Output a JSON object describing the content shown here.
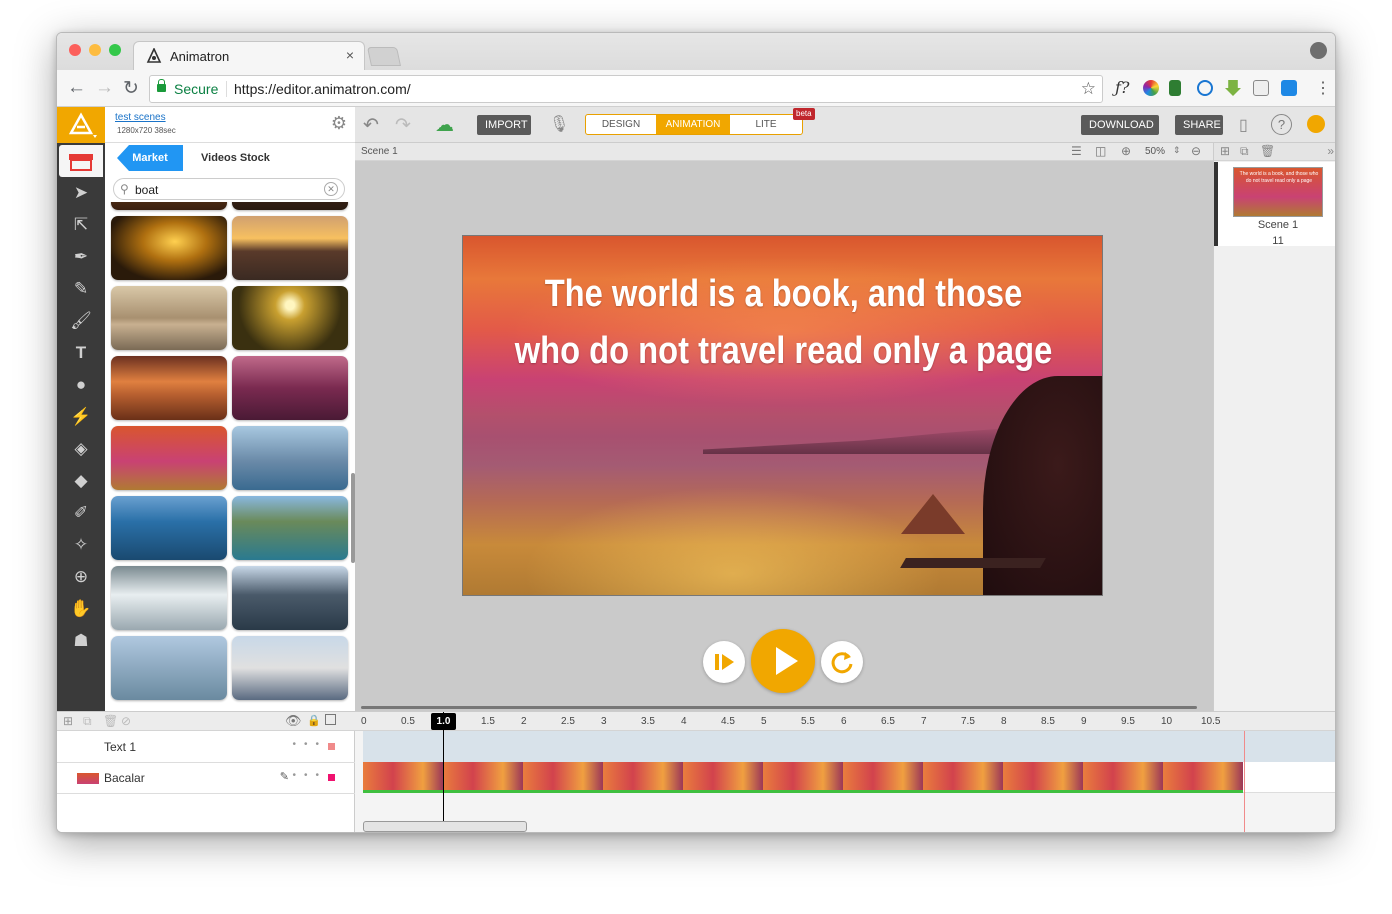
{
  "browser": {
    "tab_title": "Animatron",
    "tab_close": "×",
    "secure_label": "Secure",
    "url": "https://editor.animatron.com/",
    "fx_label": "ƒ?"
  },
  "project": {
    "name": "test scenes",
    "meta": "1280x720  38sec"
  },
  "toolbar": {
    "import_label": "IMPORT",
    "modes": [
      "DESIGN",
      "ANIMATION",
      "LITE"
    ],
    "active_mode": "ANIMATION",
    "beta_label": "beta",
    "download_label": "DOWNLOAD",
    "share_label": "SHARE",
    "help_label": "?"
  },
  "library": {
    "tabs": [
      "Market",
      "Videos Stock"
    ],
    "active_tab": "Market",
    "search_value": "boat"
  },
  "canvas": {
    "breadcrumb": "Scene 1",
    "zoom": "50%",
    "quote_line1": "The world is a book, and those",
    "quote_line2": "who do not travel read only a page"
  },
  "scenes": [
    {
      "name": "Scene 1",
      "number": "11",
      "thumb_text": "The world is a book, and those who do not travel read only a page"
    }
  ],
  "timeline": {
    "playhead": "1.0",
    "ticks": [
      "0",
      "0.5",
      "1.0",
      "1.5",
      "2",
      "2.5",
      "3",
      "3.5",
      "4",
      "4.5",
      "5",
      "5.5",
      "6",
      "6.5",
      "7",
      "7.5",
      "8",
      "8.5",
      "9",
      "9.5",
      "10",
      "10.5"
    ],
    "layers": [
      {
        "name": "Text 1"
      },
      {
        "name": "Bacalar"
      }
    ]
  },
  "colors": {
    "accent": "#f1a700",
    "market_tab": "#2196f3",
    "beta": "#c0272d"
  }
}
